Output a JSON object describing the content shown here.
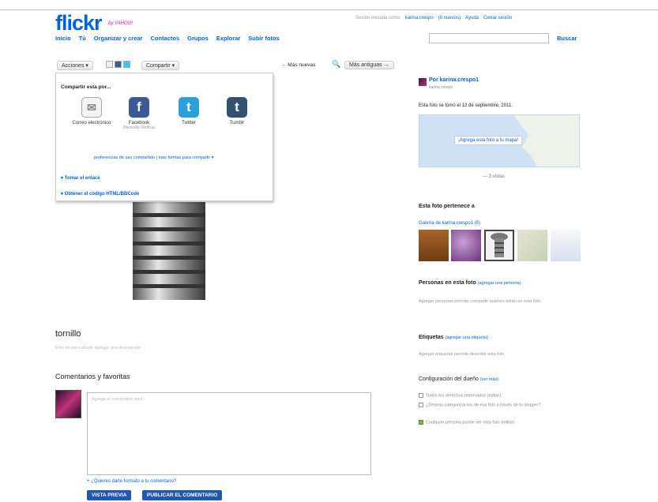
{
  "header": {
    "logo_main": "flickr",
    "logo_suffix": "",
    "logo_tagline": "by YAHOO!",
    "nav": [
      "Inicio",
      "Tú",
      "Organizar y crear",
      "Contactos",
      "Grupos",
      "Explorar",
      "Subir fotos"
    ],
    "toplinks": {
      "signed_in": "Sesión iniciada como",
      "user": "karina.crespo",
      "new": "(0 nuevos)",
      "help": "Ayuda",
      "signout": "Cerrar sesión"
    },
    "search_button": "Buscar"
  },
  "toolbar": {
    "acciones": "Acciones",
    "compartir": "Compartir",
    "mas_nuevas": "← Más nuevas",
    "mas_antiguas": "Más antiguas →"
  },
  "share_panel": {
    "title": "Compartir esta por...",
    "services": [
      {
        "name": "Correo electrónico",
        "sub": ""
      },
      {
        "name": "Facebook",
        "sub": "(Necesita Verifica)"
      },
      {
        "name": "Twitter",
        "sub": ""
      },
      {
        "name": "Tumblr",
        "sub": ""
      }
    ],
    "prefs": "preferencias de uso compartido  |  más formas para compartir ▾",
    "link": "▾ Tomar el enlace",
    "code": "▾ Obtener el código HTML/BBCode"
  },
  "photo": {
    "title": "tornillo",
    "description": "Este es para añadir agregar una descripción"
  },
  "comments": {
    "title": "Comentarios y favoritas",
    "placeholder": "Agrega el comentario aquí...",
    "format_link": "+ ¿Quieres darle formato a tu comentario?",
    "preview": "VISTA PREVIA",
    "publish": "PUBLICAR EL COMENTARIO"
  },
  "sidebar": {
    "by_label": "Por karina.crespo1",
    "owner_name": "karina crespo",
    "taken": "Esta foto se tomó el 12 de septiembre, 2011.",
    "map_button": "¡Agrega esta foto a tu mapa!",
    "views": "— 3 vistas",
    "belongs_title": "Esta foto pertenece a",
    "gallery_link": "Galería de karina.crespo1 (5)",
    "people_title": "Personas en esta foto",
    "people_add": "(agregar una persona)",
    "people_desc": "Agregar personas permite compartir quiénes están en esta foto.",
    "tags_title": "Etiquetas",
    "tags_add": "(agregar una etiqueta)",
    "tags_desc": "Agregar etiquetas permite describir esta foto",
    "settings_title": "Configuración del dueño",
    "settings_more": "(ver más)",
    "settings": [
      "Todos los derechos reservados (editar)",
      "¿Deseas categorizar los de esa foto a través de tu imagen?",
      "Cualquier persona puede ver esta foto (editar)"
    ]
  }
}
